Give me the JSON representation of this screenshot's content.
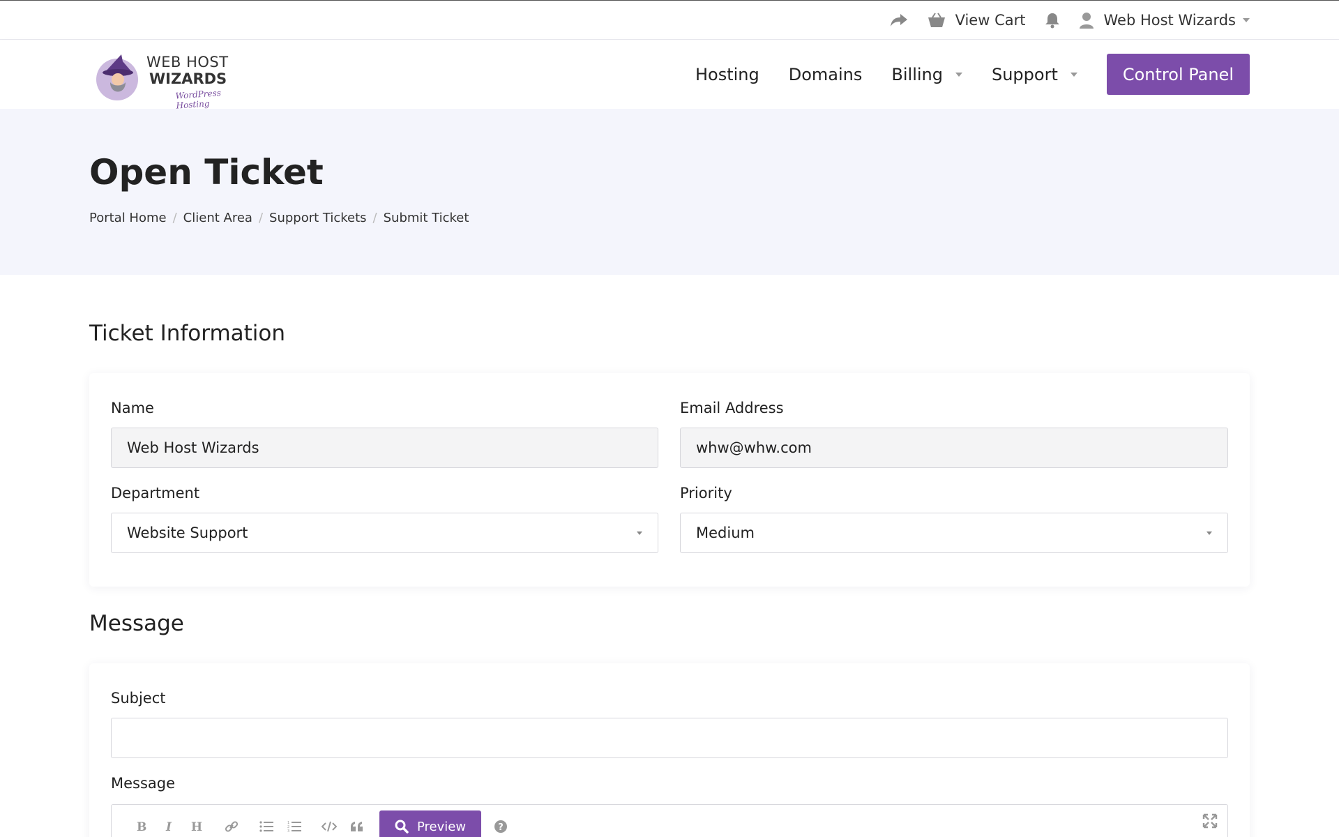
{
  "topbar": {
    "cart_label": "View Cart",
    "account_label": "Web Host Wizards"
  },
  "brand": {
    "line1": "WEB HOST",
    "line2": "WIZARDS",
    "tagline": "WordPress Hosting",
    "accent_color": "#7c4daa"
  },
  "nav": {
    "items": [
      {
        "label": "Hosting"
      },
      {
        "label": "Domains"
      },
      {
        "label": "Billing"
      },
      {
        "label": "Support"
      }
    ],
    "cta_label": "Control Panel"
  },
  "page": {
    "title": "Open Ticket",
    "breadcrumb": [
      "Portal Home",
      "Client Area",
      "Support Tickets",
      "Submit Ticket"
    ]
  },
  "ticket_info": {
    "heading": "Ticket Information",
    "name_label": "Name",
    "name_value": "Web Host Wizards",
    "email_label": "Email Address",
    "email_value": "whw@whw.com",
    "department_label": "Department",
    "department_value": "Website Support",
    "priority_label": "Priority",
    "priority_value": "Medium"
  },
  "message": {
    "heading": "Message",
    "subject_label": "Subject",
    "subject_value": "",
    "message_label": "Message",
    "toolbar": {
      "icons": [
        "bold-icon",
        "italic-icon",
        "heading-icon",
        "link-icon",
        "unordered-list-icon",
        "ordered-list-icon",
        "code-icon",
        "quote-icon"
      ],
      "preview_label": "Preview",
      "help_icon": "help-icon",
      "fullscreen_icon": "fullscreen-icon"
    }
  }
}
